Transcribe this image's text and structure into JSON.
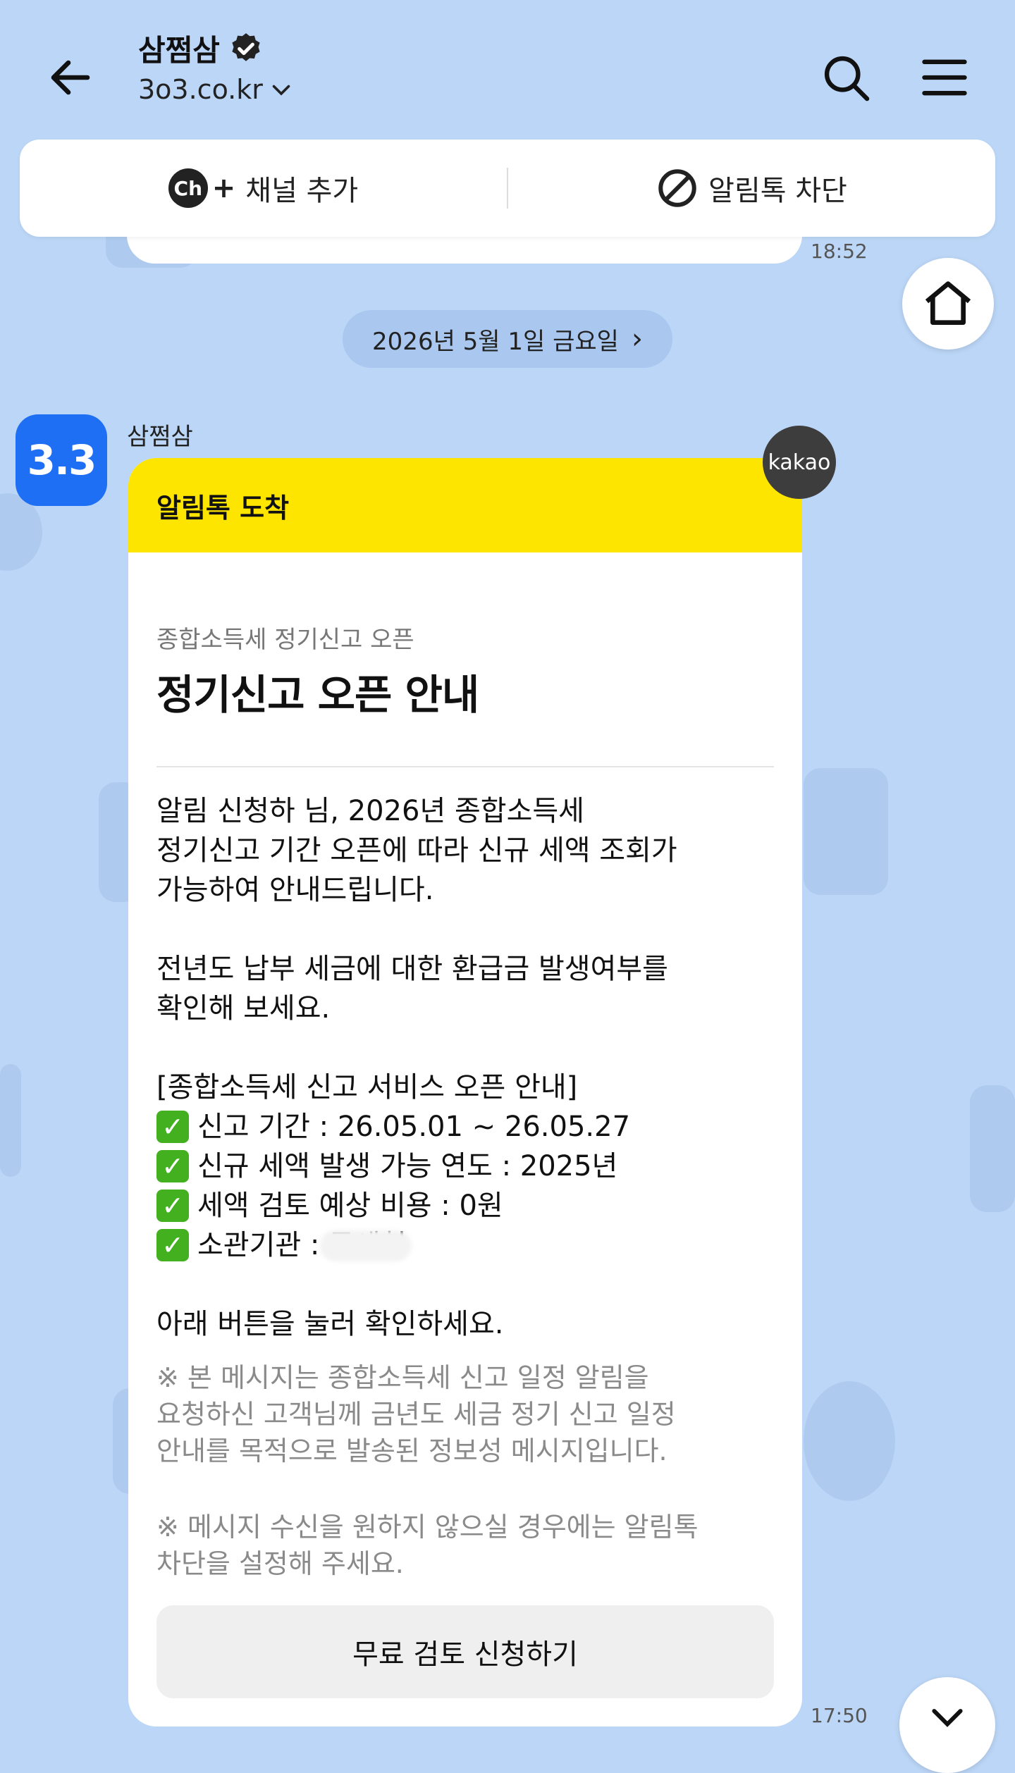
{
  "header": {
    "channel_name": "삼쩜삼",
    "channel_domain": "3o3.co.kr",
    "verified_icon": "verified-badge-icon",
    "back_icon": "arrow-left-icon",
    "search_icon": "search-icon",
    "menu_icon": "hamburger-menu-icon"
  },
  "action_bar": {
    "add_channel_badge": "Ch",
    "add_channel_plus": "+",
    "add_channel_label": "채널 추가",
    "block_label": "알림톡 차단"
  },
  "previous_message": {
    "time": "18:52"
  },
  "date_separator": {
    "label": "2026년 5월 1일 금요일",
    "arrow": "›"
  },
  "message": {
    "sender": "삼쩜삼",
    "avatar_text": "3.3",
    "badge": "kakao",
    "header": "알림톡 도착",
    "subtitle": "종합소득세 정기신고 오픈",
    "title": "정기신고 오픈 안내",
    "para1_line1": "알림 신청하          님, 2026년 종합소득세",
    "para1_line2": "정기신고 기간 오픈에 따라 신규 세액 조회가",
    "para1_line3": "가능하여 안내드립니다.",
    "para2_line1": "전년도 납부 세금에 대한 환급금 발생여부를",
    "para2_line2": "확인해 보세요.",
    "section_title": "[종합소득세 신고 서비스 오픈 안내]",
    "checklist": [
      "신고 기간 : 26.05.01 ~ 26.05.27",
      "신규 세액 발생 가능 연도 : 2025년",
      "세액 검토 예상 비용 : 0원",
      "소관기관 : 국세청"
    ],
    "check_glyph": "✓",
    "prompt": "아래 버튼을 눌러 확인하세요.",
    "note1_line1": "※ 본 메시지는 종합소득세 신고 일정 알림을",
    "note1_line2": "요청하신 고객님께 금년도 세금 정기 신고 일정",
    "note1_line3": "안내를 목적으로 발송된 정보성 메시지입니다.",
    "note2_line1": "※ 메시지 수신을 원하지 않으실 경우에는 알림톡",
    "note2_line2": "차단을 설정해 주세요.",
    "cta_label": "무료 검토 신청하기",
    "time": "17:50"
  },
  "colors": {
    "background": "#bcd6f7",
    "card_header": "#fde500",
    "avatar": "#1e6ff3",
    "check": "#43b020"
  }
}
